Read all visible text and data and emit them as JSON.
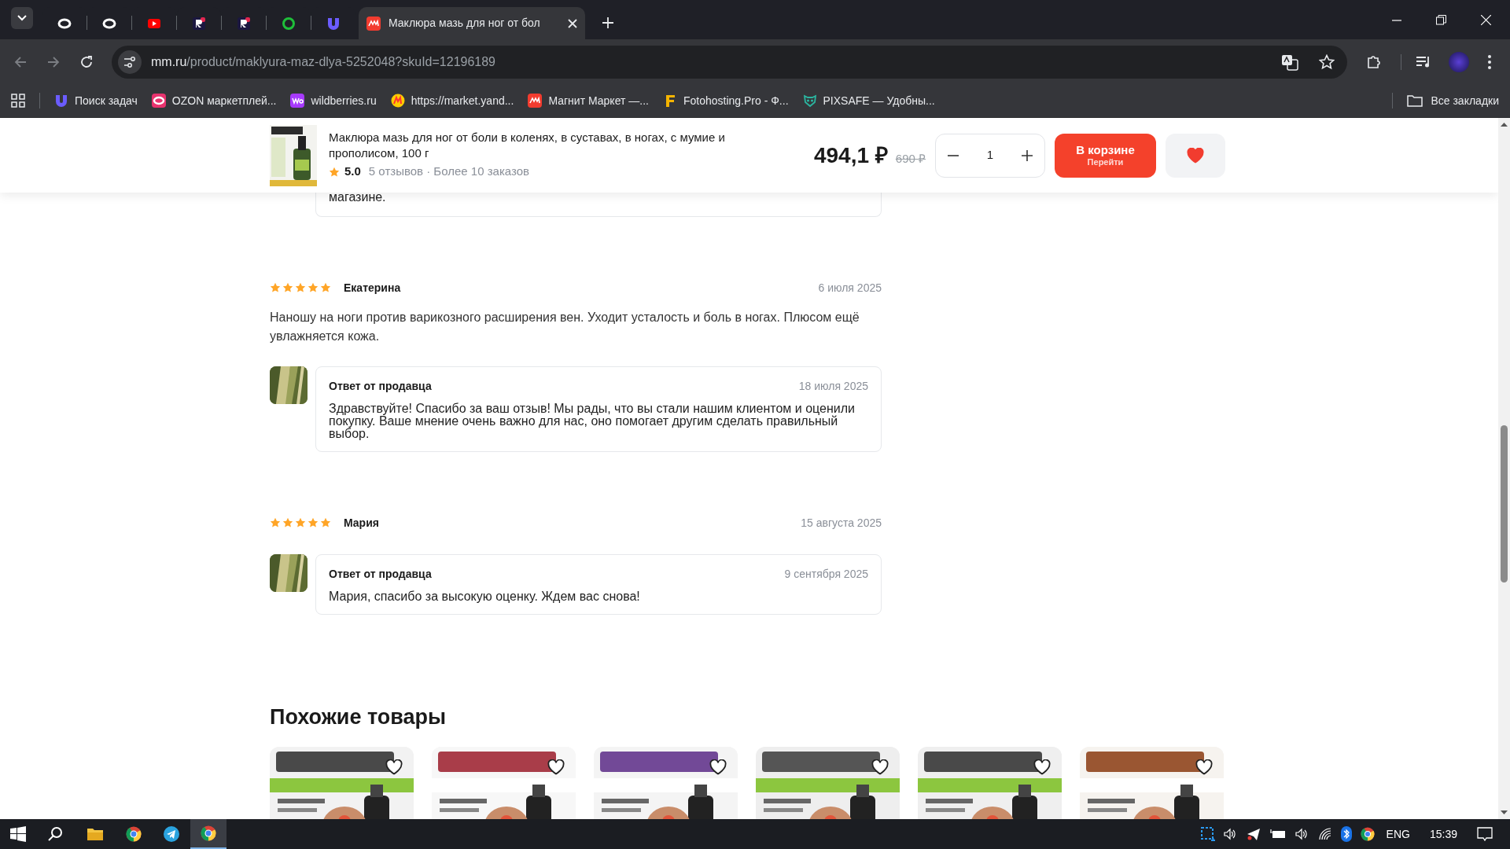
{
  "browser": {
    "tabs": [
      {
        "kind": "ring",
        "selected": false
      },
      {
        "kind": "ring",
        "selected": false
      },
      {
        "kind": "youtube",
        "selected": false
      },
      {
        "kind": "r",
        "selected": false
      },
      {
        "kind": "r",
        "selected": false
      },
      {
        "kind": "green-ring",
        "selected": false
      },
      {
        "kind": "u",
        "selected": false
      },
      {
        "kind": "mm",
        "title": "Маклюра мазь для ног от бол",
        "selected": true
      }
    ],
    "address": {
      "host": "mm.ru",
      "path": "/product/maklyura-maz-dlya-5252048?skuId=12196189"
    },
    "bookmarks": [
      {
        "kind": "u",
        "label": "Поиск задач"
      },
      {
        "kind": "ozon",
        "label": "OZON маркетплей..."
      },
      {
        "kind": "wb",
        "label": "wildberries.ru"
      },
      {
        "kind": "yandex",
        "label": "https://market.yand..."
      },
      {
        "kind": "mm",
        "label": "Магнит Маркет —..."
      },
      {
        "kind": "f",
        "label": "Fotohosting.Pro - Ф..."
      },
      {
        "kind": "owl",
        "label": "PIXSAFE — Удобны..."
      }
    ],
    "all_bookmarks": "Все закладки"
  },
  "sticky": {
    "title": "Маклюра мазь для ног от боли в коленях, в суставах, в ногах, с мумие и прополисом, 100 г",
    "rating": "5.0",
    "meta": "5 отзывов · Более 10 заказов",
    "price": "494,1 ₽",
    "old_price": "690 ₽",
    "quantity": "1",
    "cart_button": "В корзине",
    "cart_sub": "Перейти",
    "favorite": true
  },
  "partial_reply_text": "магазине.",
  "reviews": [
    {
      "stars": 5,
      "author": "Екатерина",
      "date": "6 июля 2025",
      "text": "Наношу на ноги против варикозного расширения вен. Уходит усталость и боль в ногах. Плюсом ещё увлажняется кожа.",
      "reply": {
        "title": "Ответ от продавца",
        "date": "18 июля 2025",
        "text": "Здравствуйте! Спасибо за ваш отзыв! Мы рады, что вы стали нашим клиентом и оценили покупку. Ваше мнение очень важно для нас, оно помогает другим сделать правильный выбор."
      }
    },
    {
      "stars": 5,
      "author": "Мария",
      "date": "15 августа 2025",
      "reply": {
        "title": "Ответ от продавца",
        "date": "9 сентября 2025",
        "text": "Мария, спасибо за высокую оценку. Ждем вас снова!"
      }
    }
  ],
  "similar": {
    "title": "Похожие товары"
  },
  "taskbar": {
    "language": "ENG",
    "time": "15:39"
  }
}
